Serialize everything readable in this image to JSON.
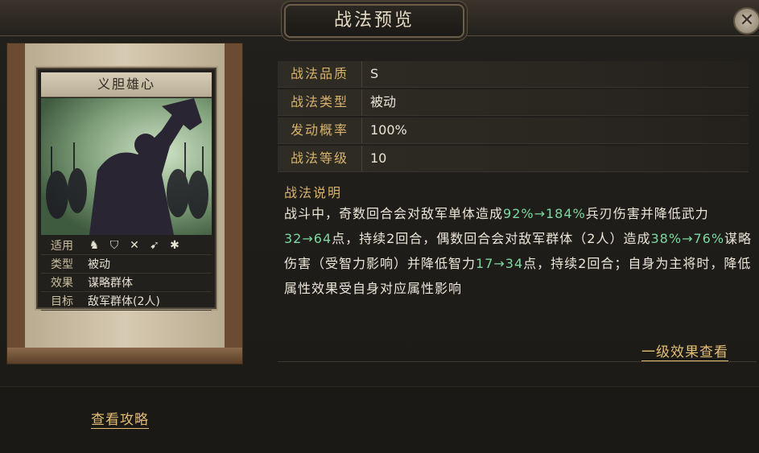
{
  "header": {
    "title": "战法预览",
    "close_label": "✕"
  },
  "card": {
    "name": "义胆雄心",
    "rows": {
      "applicable_label": "适用",
      "type_label": "类型",
      "type_value": "被动",
      "effect_label": "效果",
      "effect_value": "谋略群体",
      "target_label": "目标",
      "target_value": "敌军群体(2人)"
    },
    "unit_icons": [
      "cavalry-icon",
      "shield-icon",
      "bow-icon",
      "spear-icon",
      "siege-wheel-icon"
    ]
  },
  "info": {
    "quality_label": "战法品质",
    "quality_value": "S",
    "type_label": "战法类型",
    "type_value": "被动",
    "rate_label": "发动概率",
    "rate_value": "100%",
    "level_label": "战法等级",
    "level_value": "10"
  },
  "description": {
    "label": "战法说明",
    "parts": [
      {
        "text": "战斗中，奇数回合会对敌军单体造成",
        "hl": false
      },
      {
        "text": "92%→184%",
        "hl": true
      },
      {
        "text": "兵刃伤害并降低武力",
        "hl": false
      },
      {
        "text": "32→64",
        "hl": true
      },
      {
        "text": "点，持续2回合，偶数回合会对敌军群体（2人）造成",
        "hl": false
      },
      {
        "text": "38%→76%",
        "hl": true
      },
      {
        "text": "谋略伤害（受智力影响）并降低智力",
        "hl": false
      },
      {
        "text": "17→34",
        "hl": true
      },
      {
        "text": "点，持续2回合；自身为主将时，降低属性效果受自身对应属性影响",
        "hl": false
      }
    ]
  },
  "links": {
    "level1_effect": "一级效果查看",
    "guide": "查看攻略"
  },
  "colors": {
    "highlight": "#7fd6a0",
    "gold": "#d8b36c",
    "link": "#e3be74"
  }
}
